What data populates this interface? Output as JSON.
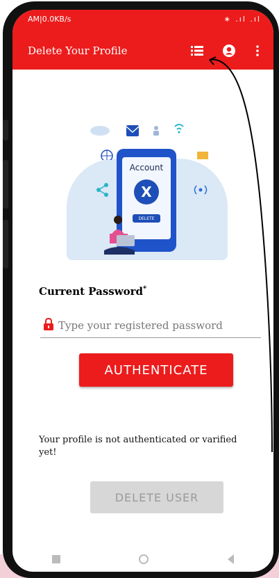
{
  "status_bar": {
    "left": "AM|0.0KB/s",
    "right": "∗ .ıl .ıl"
  },
  "toolbar": {
    "title": "Delete Your Profile",
    "icons": [
      "list-icon",
      "account-circle-icon",
      "more-vert-icon"
    ]
  },
  "illustration": {
    "account_label": "Account",
    "x_symbol": "X",
    "delete_label": "DELETE"
  },
  "form": {
    "password_label": "Current Password",
    "required_mark": "*",
    "password_placeholder": "Type your registered password",
    "authenticate_label": "AUTHENTICATE"
  },
  "status_message": "Your profile is not authenticated or varified yet!",
  "delete_button_label": "DELETE USER",
  "colors": {
    "primary_red": "#ec1c1c",
    "disabled_grey": "#d7d7d7",
    "illustration_blue": "#1f53c9"
  }
}
